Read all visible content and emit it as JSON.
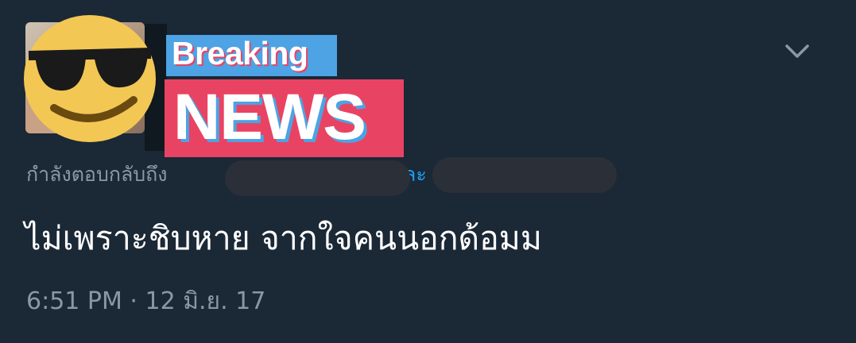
{
  "tweet": {
    "badge_breaking": "Breaking",
    "badge_news": "NEWS",
    "reply_context_prefix": "กำลังตอบกลับถึง",
    "reply_context_fragment": "ละ",
    "text": "ไม่เพราะชิบหาย จากใจคนนอกด้อมม",
    "timestamp": "6:51 PM · 12 มิ.ย. 17",
    "menu_icon": "chevron-down-icon"
  },
  "colors": {
    "background": "#1b2836",
    "muted_text": "#8899a6",
    "link": "#1da1f2",
    "breaking_blue": "#4da3e3",
    "news_red": "#e94363"
  }
}
